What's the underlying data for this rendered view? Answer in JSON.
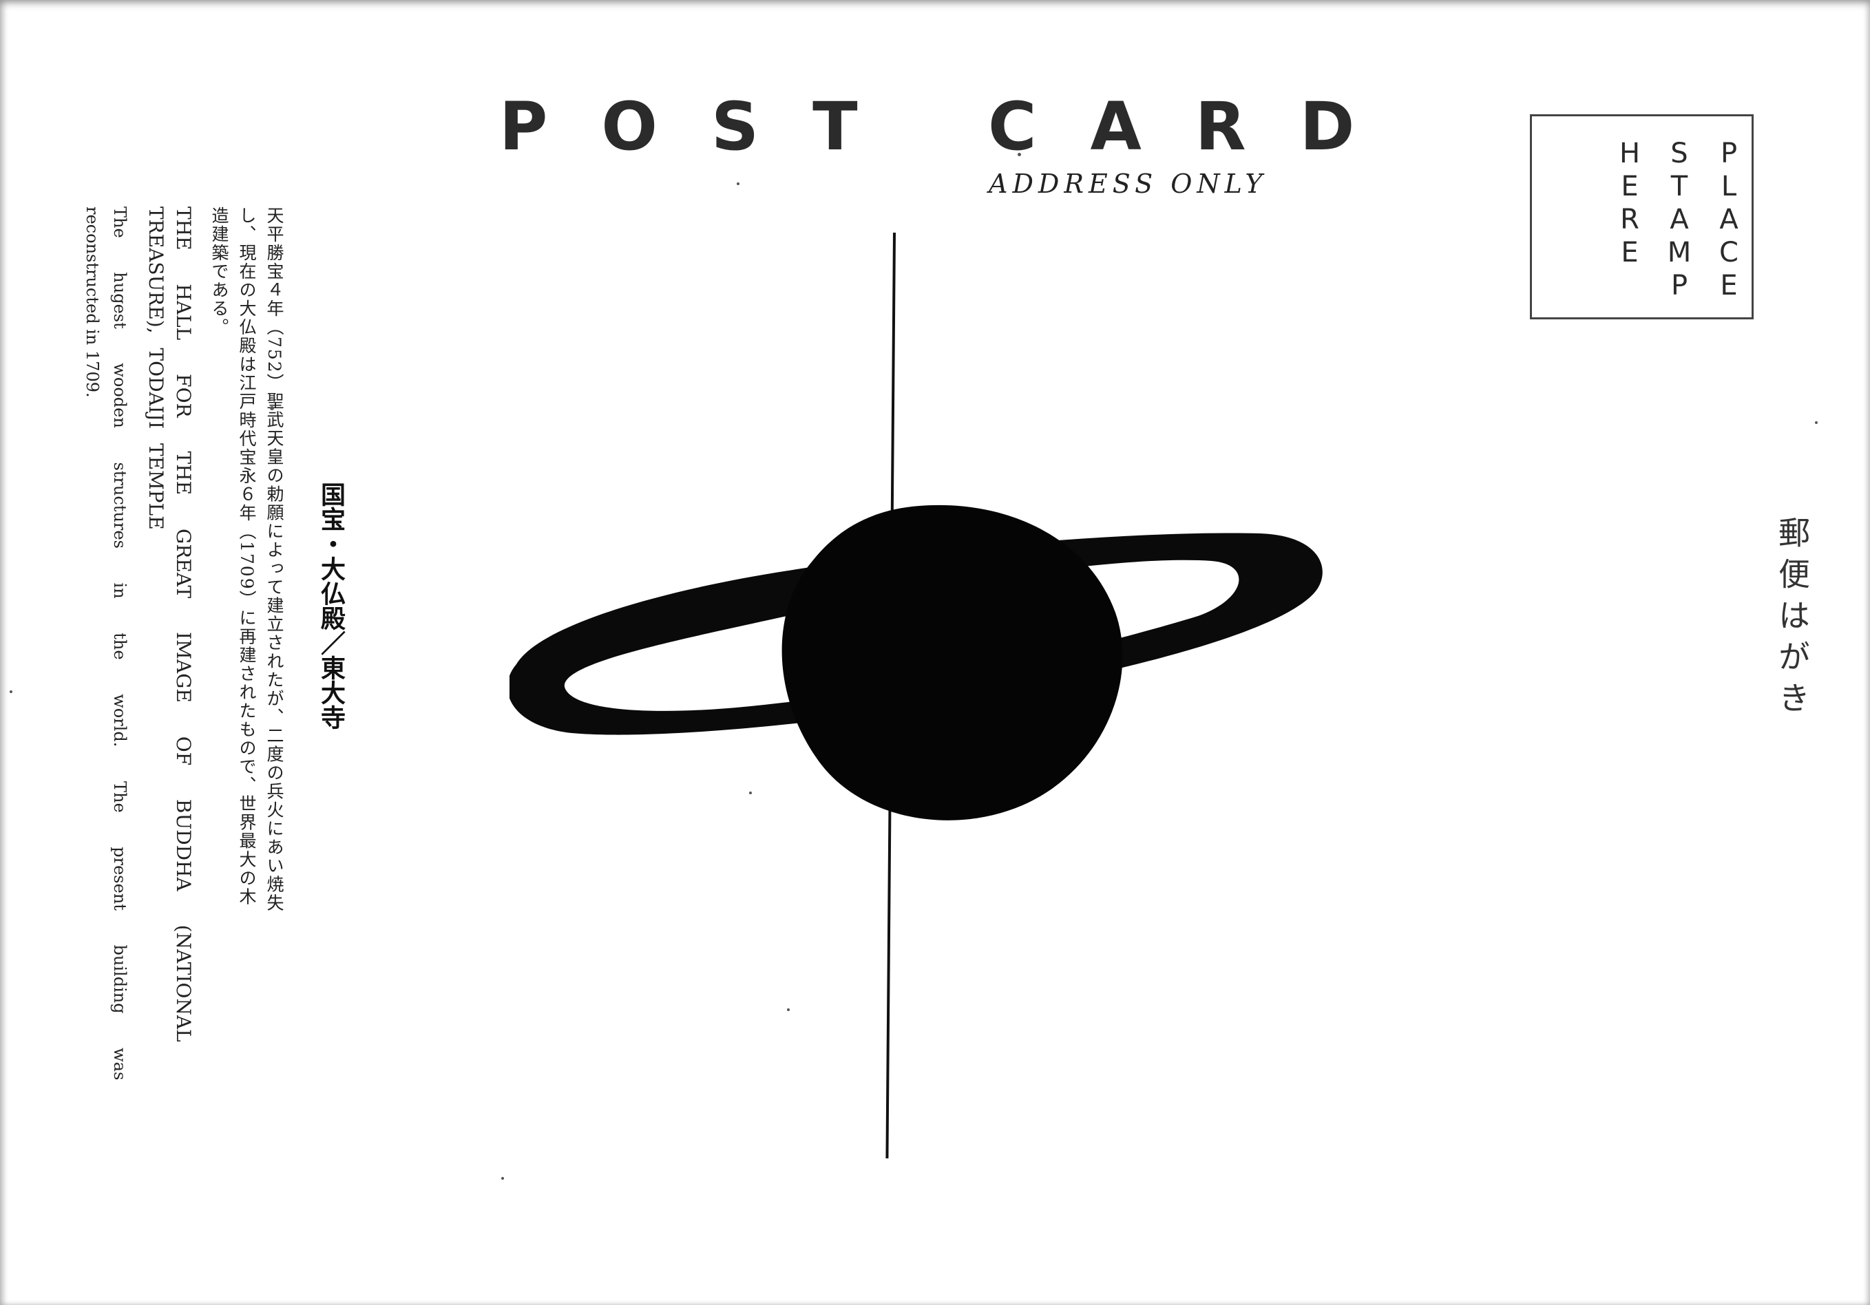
{
  "card": {
    "title": "POST CARD",
    "subtitle": "ADDRESS ONLY",
    "stamp_box": [
      "PLACE",
      "STAMP",
      "HERE"
    ],
    "japanese_label": "郵便はがき"
  },
  "caption": {
    "heading": "国宝・大仏殿／東大寺",
    "japanese_lines": [
      "天平勝宝４年（752）聖武天皇の勅願によって建立されたが、二度の兵火にあい焼失",
      "し、現在の大仏殿は江戸時代宝永６年（1709）に再建されたもので、世界最大の木",
      "造建築である。"
    ],
    "english_lines": [
      "THE HALL FOR THE GREAT IMAGE OF BUDDHA (NATIONAL",
      "TREASURE), TODAIJI TEMPLE",
      "The hugest wooden structures in the world. The present building was",
      "reconstructed in 1709."
    ]
  },
  "colors": {
    "ink": "#111111",
    "paper": "#ffffff"
  },
  "icons": {
    "drawing": "saturn-planet-drawing"
  }
}
